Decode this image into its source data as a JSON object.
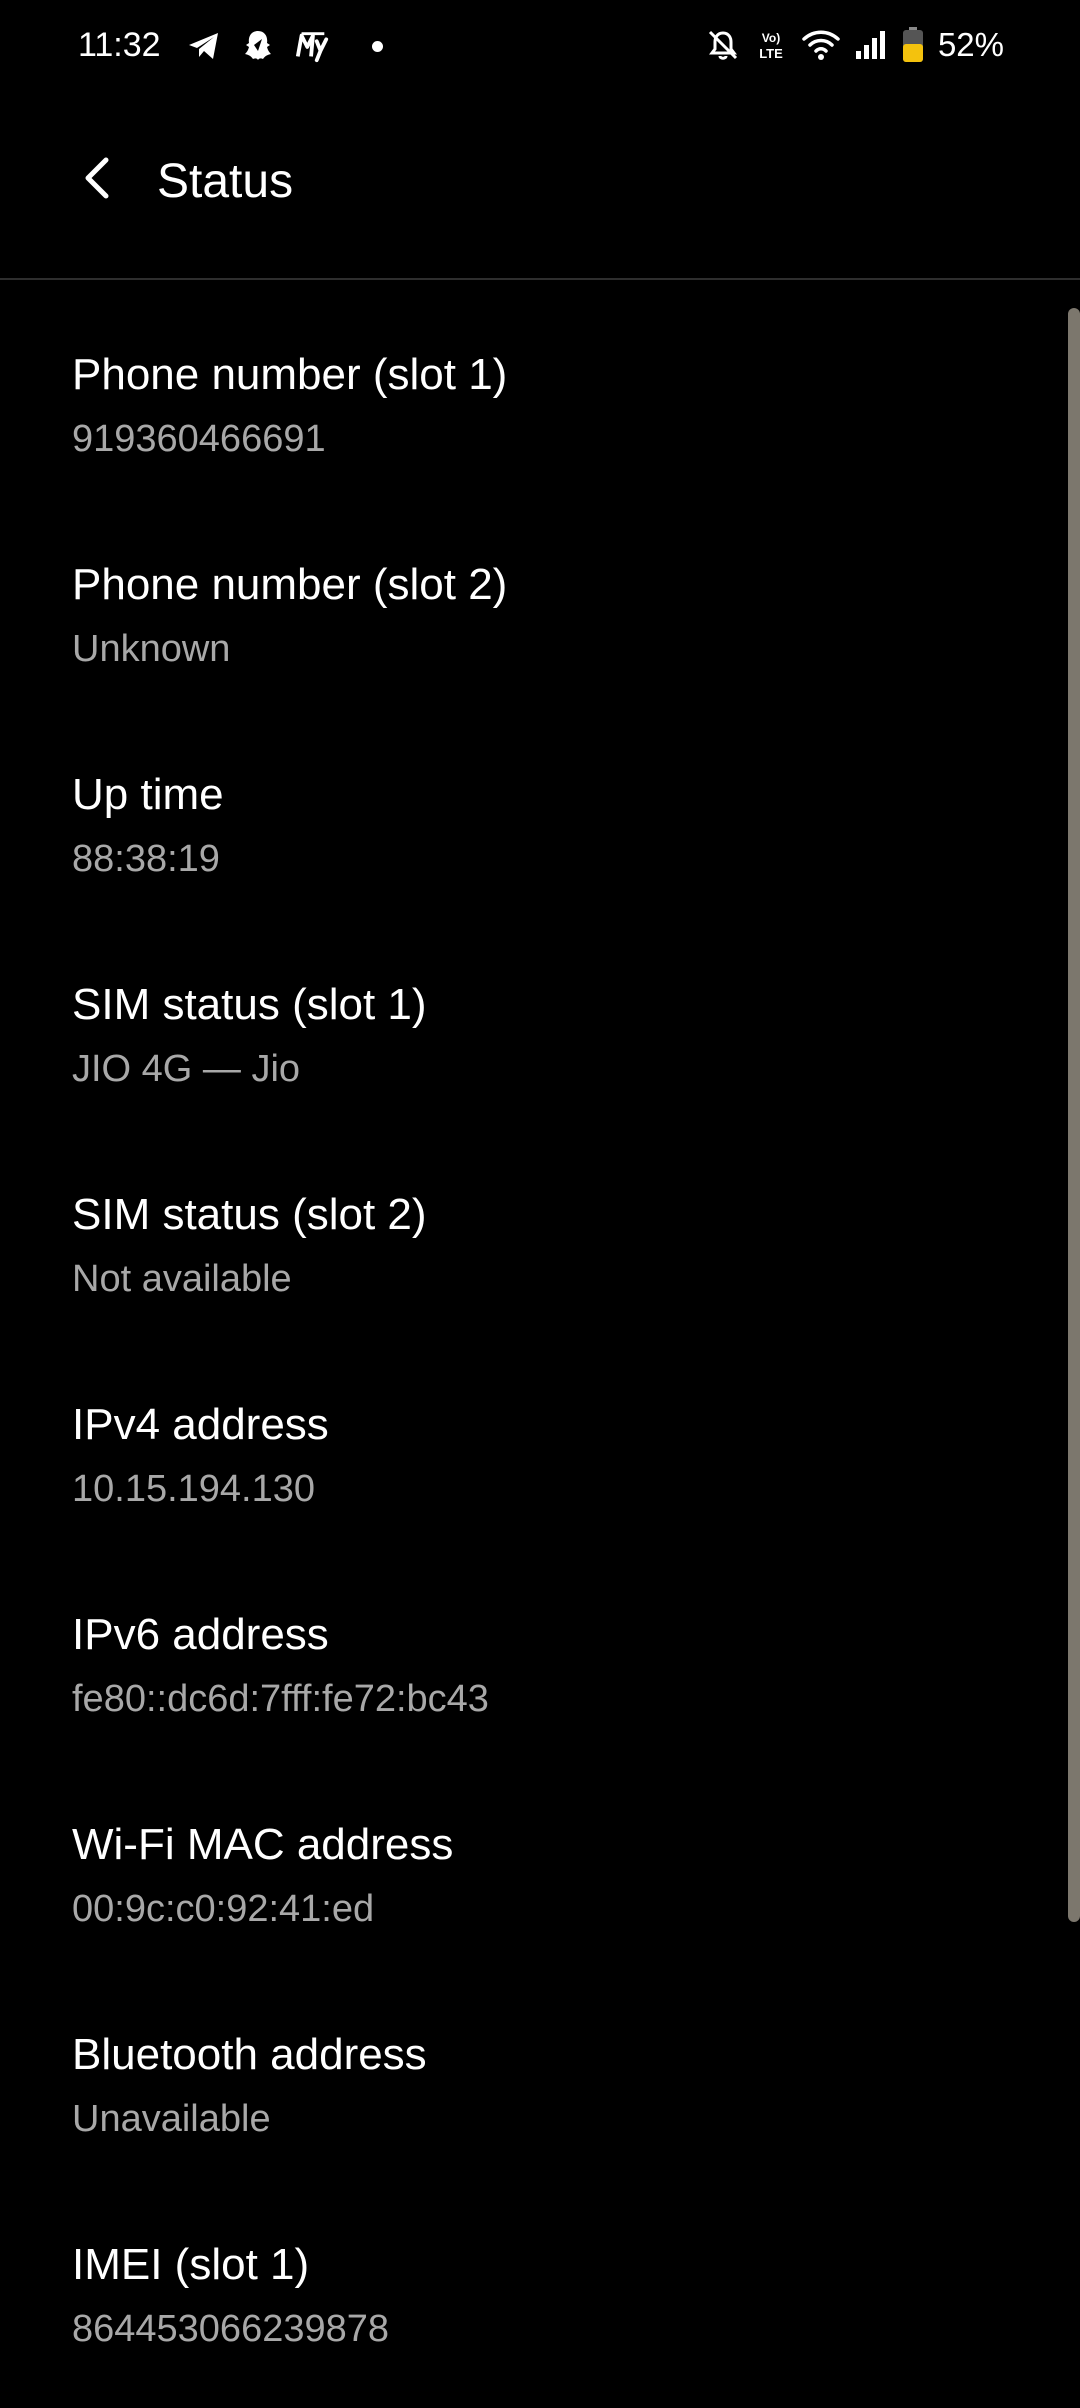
{
  "status_bar": {
    "time": "11:32",
    "left_icons": [
      "telegram-icon",
      "snapchat-like-icon",
      "myjio-icon"
    ],
    "right_icons": [
      "bell-off-icon",
      "volte-icon",
      "wifi-icon",
      "signal-icon",
      "battery-icon"
    ],
    "battery_percent": "52%",
    "battery_color": "#f4c20d"
  },
  "app_bar": {
    "back_icon": "back-arrow-icon",
    "title": "Status"
  },
  "items": [
    {
      "title": "Phone number (slot 1)",
      "value": "919360466691"
    },
    {
      "title": "Phone number (slot 2)",
      "value": "Unknown"
    },
    {
      "title": "Up time",
      "value": "88:38:19"
    },
    {
      "title": "SIM status (slot 1)",
      "value": "JIO 4G — Jio"
    },
    {
      "title": "SIM status (slot 2)",
      "value": "Not available"
    },
    {
      "title": "IPv4 address",
      "value": "10.15.194.130"
    },
    {
      "title": "IPv6 address",
      "value": "fe80::dc6d:7fff:fe72:bc43"
    },
    {
      "title": "Wi-Fi MAC address",
      "value": "00:9c:c0:92:41:ed"
    },
    {
      "title": "Bluetooth address",
      "value": "Unavailable"
    },
    {
      "title": "IMEI (slot 1)",
      "value": "864453066239878"
    }
  ],
  "colors": {
    "background": "#000000",
    "title_text": "#ffffff",
    "value_text": "#a8a8a8",
    "scrollbar": "#7c776d"
  }
}
